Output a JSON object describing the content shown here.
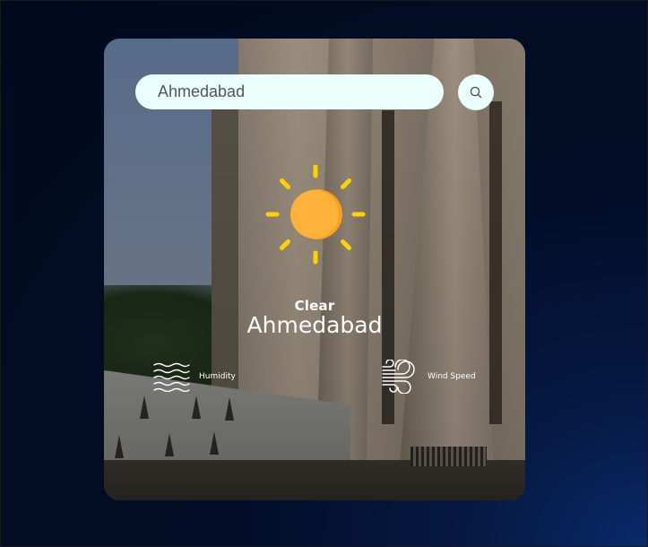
{
  "search": {
    "value": "Ahmedabad"
  },
  "icons": {
    "search": "search-icon",
    "weather": "sun-icon",
    "humidity": "humidity-waves-icon",
    "wind": "wind-icon"
  },
  "weather": {
    "condition": "Clear",
    "city": "Ahmedabad"
  },
  "details": {
    "humidity_label": "Humidity",
    "wind_label": "Wind Speed"
  },
  "colors": {
    "input_background": "#ebfffc",
    "sun_ray": "#ffd100",
    "sun_core": "#ffb02e",
    "text": "#ffffff"
  }
}
